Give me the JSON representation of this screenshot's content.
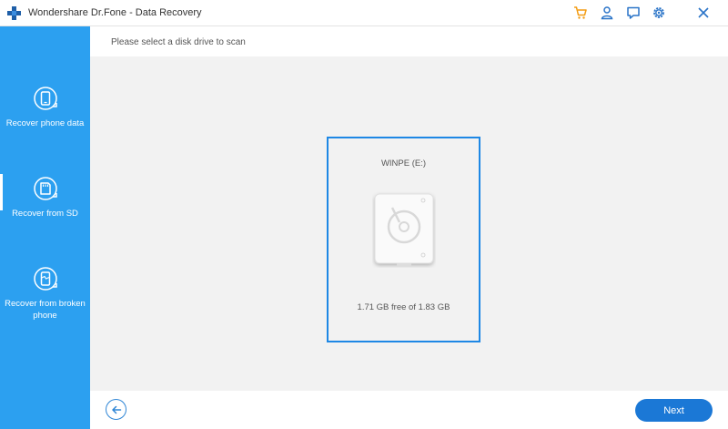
{
  "window": {
    "title": "Wondershare Dr.Fone - Data Recovery",
    "icons": [
      "cart-icon",
      "account-icon",
      "feedback-icon",
      "settings-icon",
      "close-icon"
    ]
  },
  "sidebar": {
    "items": [
      {
        "label": "Recover phone data",
        "icon": "phone-recover-icon"
      },
      {
        "label": "Recover from SD",
        "icon": "sd-card-icon"
      },
      {
        "label": "Recover from broken phone",
        "icon": "broken-phone-icon"
      }
    ]
  },
  "main": {
    "prompt": "Please select a disk drive to scan",
    "drive": {
      "name": "WINPE (E:)",
      "space": "1.71 GB free of 1.83 GB",
      "icon": "hard-drive-icon"
    },
    "back_icon": "arrow-left-icon",
    "next_label": "Next"
  },
  "colors": {
    "sidebar": "#2ca0f0",
    "accent": "#1b78d6",
    "selection_border": "#1e88e5",
    "cart": "#f39c12",
    "icons": "#2a74c8"
  }
}
